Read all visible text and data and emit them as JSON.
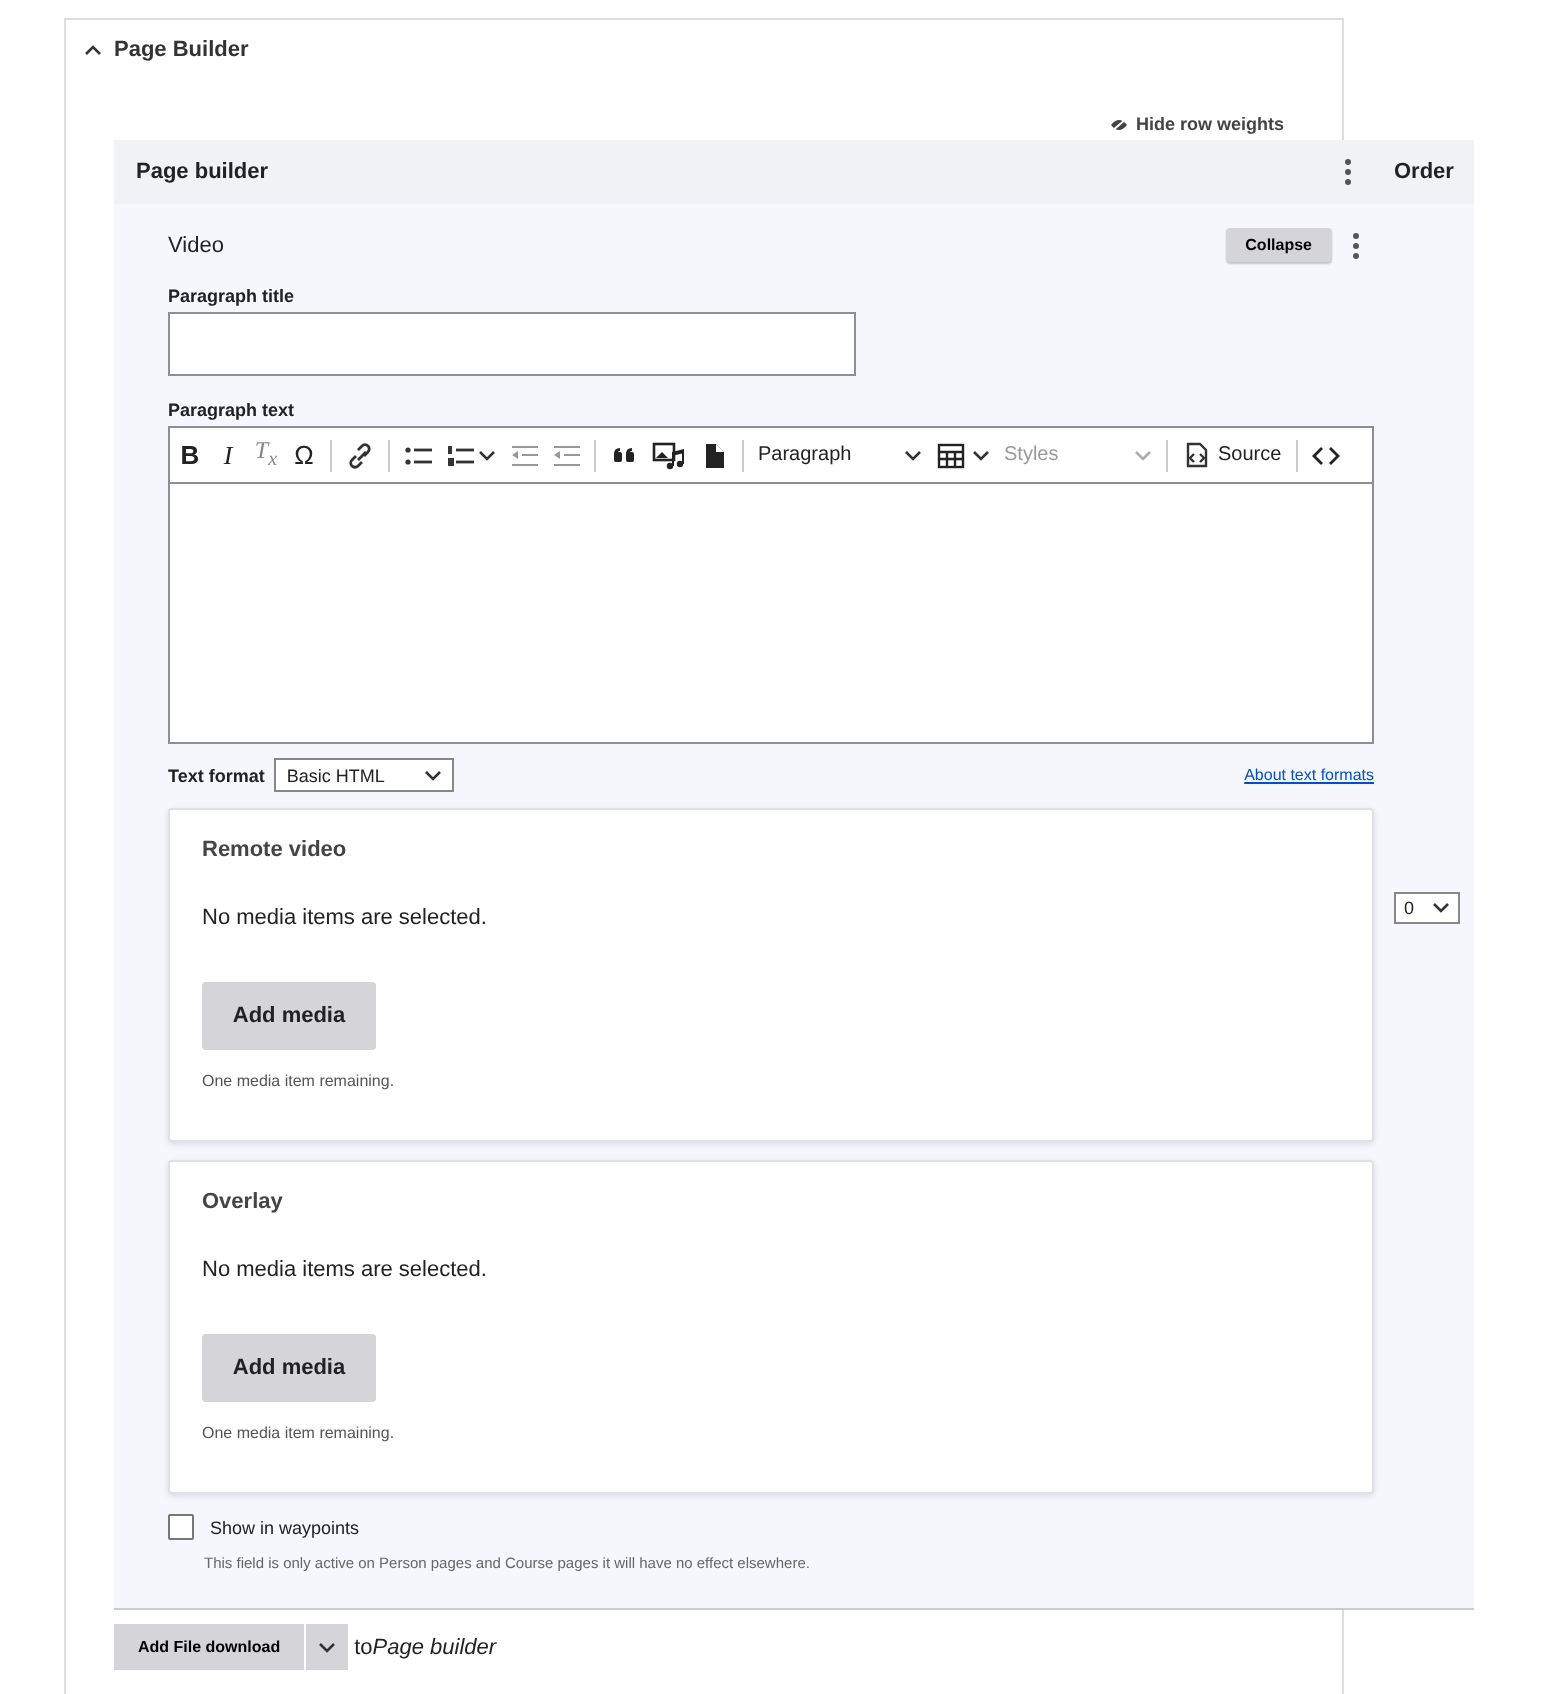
{
  "panel": {
    "title": "Page Builder",
    "expanded": true
  },
  "row_weights_link": "Hide row weights",
  "table": {
    "title": "Page builder",
    "order_header": "Order"
  },
  "paragraph": {
    "type": "Video",
    "collapse_button": "Collapse",
    "order_value": "0",
    "title_field": {
      "label": "Paragraph title"
    },
    "text_field": {
      "label": "Paragraph text",
      "toolbar": {
        "bold": "B",
        "italic": "I",
        "remove_format": "T$_{x}$",
        "special_chars": "Ω",
        "heading": "Paragraph",
        "styles": {
          "label": "Styles",
          "disabled": true
        },
        "source": "Source"
      }
    },
    "text_format": {
      "label": "Text format",
      "value": "Basic HTML",
      "help_link": "About text formats"
    },
    "media_fields": [
      {
        "title": "Remote video",
        "empty_text": "No media items are selected.",
        "button": "Add media",
        "remaining": "One media item remaining."
      },
      {
        "title": "Overlay",
        "empty_text": "No media items are selected.",
        "button": "Add media",
        "remaining": "One media item remaining."
      }
    ],
    "waypoints": {
      "label": "Show in waypoints",
      "checked": false,
      "description": "This field is only active on Person pages and Course pages it will have no effect elsewhere."
    }
  },
  "add_bar": {
    "button": "Add File download",
    "suffix": "to",
    "target": "Page builder"
  }
}
